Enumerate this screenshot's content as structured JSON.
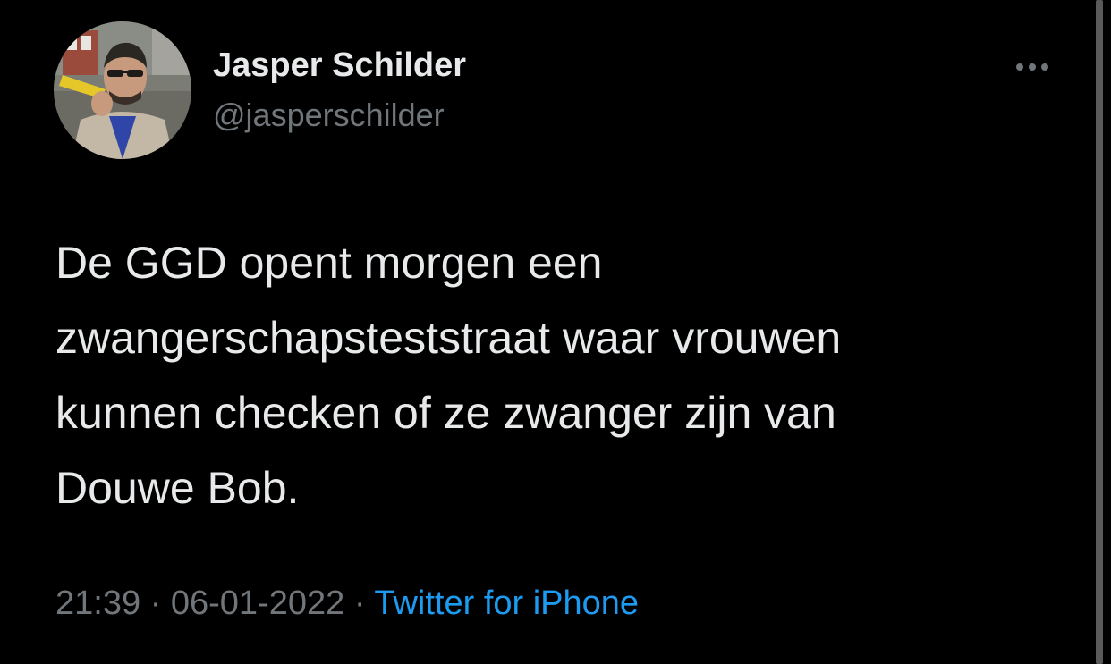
{
  "tweet": {
    "author": {
      "display_name": "Jasper Schilder",
      "handle": "@jasperschilder",
      "avatar_icon": "profile-photo"
    },
    "more_icon": "ellipsis-icon",
    "text_lines": [
      "De GGD opent morgen een",
      "zwangerschapsteststraat waar vrouwen",
      "kunnen checken of ze zwanger zijn van",
      "Douwe Bob."
    ],
    "meta": {
      "time": "21:39",
      "separator": "·",
      "date": "06-01-2022",
      "source": "Twitter for iPhone"
    }
  },
  "colors": {
    "background": "#000000",
    "primary_text": "#e7e9ea",
    "secondary_text": "#71767b",
    "link": "#1d9bf0"
  }
}
